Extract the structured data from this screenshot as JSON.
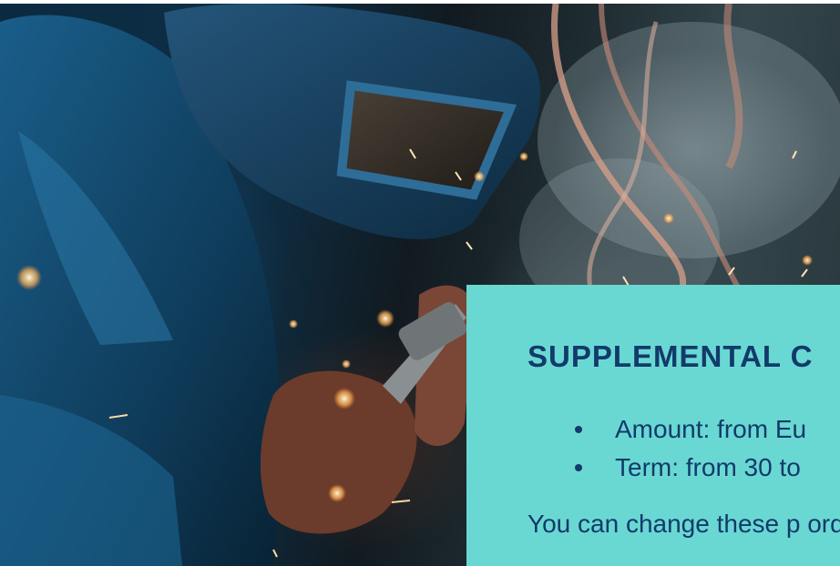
{
  "card": {
    "title": "SUPPLEMENTAL C",
    "items": [
      "Amount: from Eu",
      "Term: from 30 to"
    ],
    "paragraph": "You can change these p order to adjust your cov"
  },
  "colors": {
    "card_background": "#6ad8d2",
    "text": "#123a6b"
  }
}
